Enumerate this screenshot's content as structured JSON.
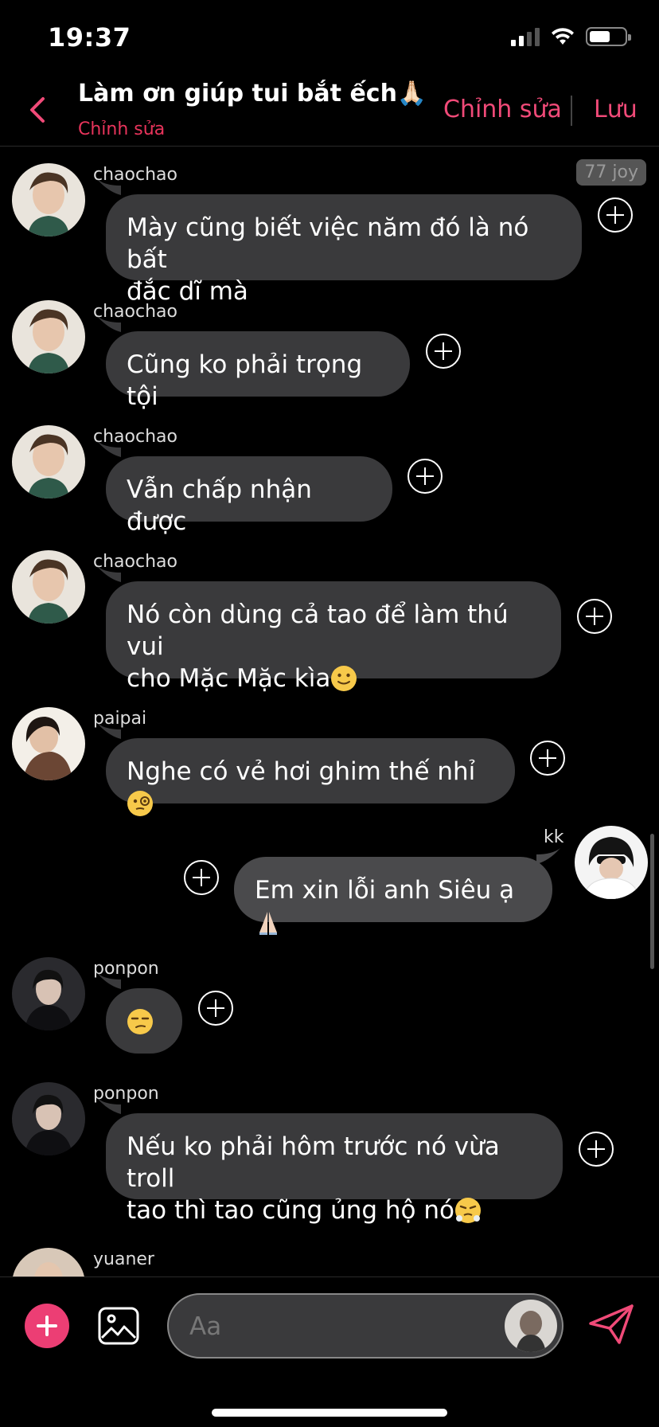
{
  "status_bar": {
    "time": "19:37"
  },
  "header": {
    "title": "Làm ơn giúp tui bắt ếch🙏🏻",
    "subtitle": "Chỉnh sửa",
    "edit_label": "Chỉnh sửa",
    "save_label": "Lưu"
  },
  "badge": "77 joy",
  "messages": [
    {
      "sender": "chaochao",
      "lines": [
        "Mày cũng biết việc năm đó là nó bất",
        "đắc dĩ mà"
      ],
      "side": "left"
    },
    {
      "sender": "chaochao",
      "lines": [
        "Cũng ko phải trọng tội"
      ],
      "side": "left"
    },
    {
      "sender": "chaochao",
      "lines": [
        "Vẫn chấp nhận được"
      ],
      "side": "left"
    },
    {
      "sender": "chaochao",
      "lines": [
        "Nó còn dùng cả tao để làm thú vui",
        "cho Mặc Mặc kìa"
      ],
      "emoji": "slightly-smiling-face",
      "side": "left"
    },
    {
      "sender": "paipai",
      "lines": [
        "Nghe có vẻ hơi ghim thế nhỉ"
      ],
      "emoji": "face-with-monocle",
      "side": "left"
    },
    {
      "sender": "kk",
      "lines": [
        "Em xin lỗi anh Siêu ạ"
      ],
      "emoji": "folded-hands",
      "side": "right"
    },
    {
      "sender": "ponpon",
      "lines": [
        ""
      ],
      "emoji": "unamused-face",
      "side": "left"
    },
    {
      "sender": "ponpon",
      "lines": [
        "Nếu ko phải hôm trước nó vừa troll",
        "tao thì tao cũng ủng hộ nó"
      ],
      "emoji": "face-with-steam",
      "side": "left"
    },
    {
      "sender": "yuaner",
      "lines": [],
      "side": "left"
    }
  ],
  "input": {
    "placeholder": "Aa"
  },
  "colors": {
    "accent": "#f04a78",
    "bubble": "#3a3a3c",
    "background": "#000000"
  }
}
